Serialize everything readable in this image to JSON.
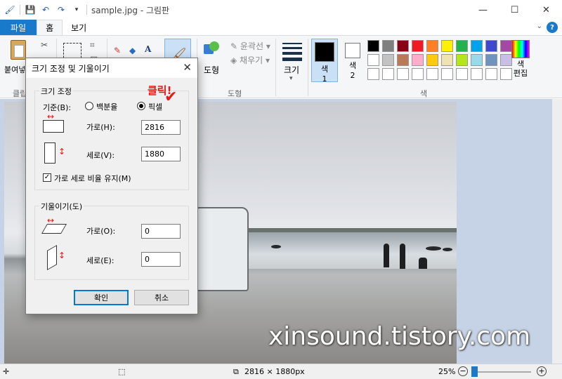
{
  "window": {
    "title": "sample.jpg - 그림판",
    "minimize": "—",
    "maximize": "☐",
    "close": "✕"
  },
  "tabs": [
    {
      "label": "파일"
    },
    {
      "label": "홈"
    },
    {
      "label": "보기"
    }
  ],
  "ribbon": {
    "paste_label": "붙여넣",
    "clipboard_group": "클립",
    "shapes_label": "도형",
    "outline_label": "윤곽선",
    "fill_label": "채우기",
    "shapes_group": "도형",
    "size_label": "크기",
    "color1_label": "색\n1",
    "color1_name": "색",
    "color1_num": "1",
    "color2_name": "색",
    "color2_num": "2",
    "edit_colors_label": "색\n편집",
    "edit_colors_a": "색",
    "edit_colors_b": "편집",
    "colors_group": "색",
    "palette": [
      "#000000",
      "#7f7f7f",
      "#880015",
      "#ed1c24",
      "#ff7f27",
      "#fff200",
      "#22b14c",
      "#00a2e8",
      "#3f48cc",
      "#a349a4",
      "#ffffff",
      "#c3c3c3",
      "#b97a57",
      "#ffaec9",
      "#ffc90e",
      "#efe4b0",
      "#b5e61d",
      "#99d9ea",
      "#7092be",
      "#c8bfe7",
      "#ffffff",
      "#ffffff",
      "#ffffff",
      "#ffffff",
      "#ffffff",
      "#ffffff",
      "#ffffff",
      "#ffffff",
      "#ffffff",
      "#ffffff"
    ],
    "color1_value": "#000000",
    "color2_value": "#ffffff"
  },
  "dialog": {
    "title": "크기 조정 및 기울이기",
    "resize_legend": "크기 조정",
    "basis_label": "기준(B):",
    "option_percent": "백분율",
    "option_pixels": "픽셀",
    "selected_option": "픽셀",
    "horizontal_label": "가로(H):",
    "horizontal_value": "2816",
    "vertical_label": "세로(V):",
    "vertical_value": "1880",
    "keep_ratio_label": "가로 세로 비율 유지(M)",
    "keep_ratio_checked": true,
    "skew_legend": "기울이기(도)",
    "skew_h_label": "가로(O):",
    "skew_h_value": "0",
    "skew_v_label": "세로(E):",
    "skew_v_value": "0",
    "ok_label": "확인",
    "cancel_label": "취소"
  },
  "annotation": {
    "click_note": "클릭!"
  },
  "canvas": {
    "watermark": "xinsound.tistory.com"
  },
  "statusbar": {
    "dimensions": "2816 × 1880px",
    "zoom": "25%",
    "zoom_fraction": 0.25
  }
}
